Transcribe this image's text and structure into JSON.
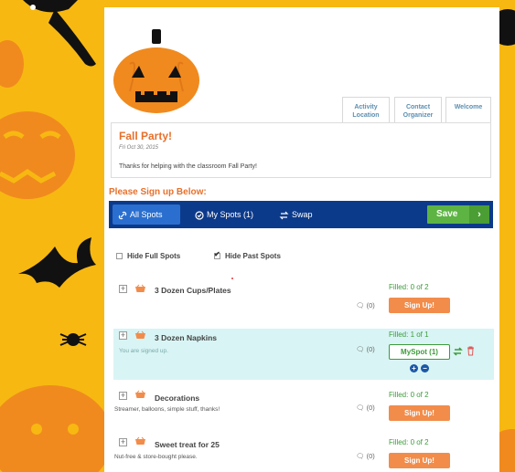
{
  "event": {
    "title": "Fall Party!",
    "date": "Fri Oct 30, 2015",
    "description": "Thanks for helping with the classroom Fall Party!"
  },
  "tabs": [
    {
      "label_line1": "Activity",
      "label_line2": "Location"
    },
    {
      "label_line1": "Contact",
      "label_line2": "Organizer"
    },
    {
      "label_line1": "Welcome",
      "label_line2": ""
    }
  ],
  "signup_heading": "Please Sign up Below:",
  "toolbar": {
    "all_spots": "All Spots",
    "my_spots": "My Spots (1)",
    "swap": "Swap",
    "save": "Save"
  },
  "filters": {
    "hide_full": "Hide Full Spots",
    "hide_past": "Hide Past Spots"
  },
  "items": [
    {
      "name": "3 Dozen Cups/Plates",
      "note": "",
      "comments": "(0)",
      "filled": "Filled: 0 of 2",
      "action": "Sign Up!"
    },
    {
      "name": "3 Dozen Napkins",
      "note": "You are signed up.",
      "comments": "(0)",
      "filled": "Filled: 1 of 1",
      "action": "MySpot (1)"
    },
    {
      "name": "Decorations",
      "note": "Streamer, balloons, simple stuff, thanks!",
      "comments": "(0)",
      "filled": "Filled: 0 of 2",
      "action": "Sign Up!"
    },
    {
      "name": "Sweet treat for 25",
      "note": "Nut-free & store-bought please.",
      "comments": "(0)",
      "filled": "Filled: 0 of 2",
      "action": "Sign Up!"
    }
  ],
  "colors": {
    "accent_orange": "#e7702a",
    "toolbar_blue": "#0c3a8b",
    "save_green": "#5db443",
    "filled_green": "#3d9b3a",
    "highlight_row": "#d9f4f4",
    "background_yellow": "#f7b812"
  }
}
